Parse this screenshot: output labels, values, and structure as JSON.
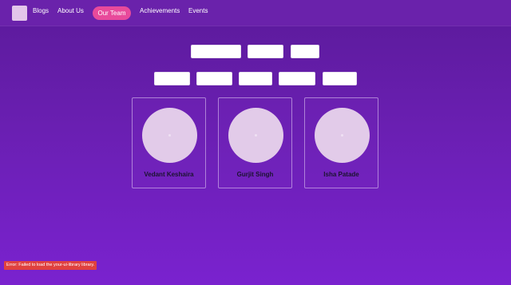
{
  "nav": {
    "items": [
      {
        "label": "Blogs"
      },
      {
        "label": "About Us"
      },
      {
        "label": "Our Team",
        "active": true
      },
      {
        "label": "Achievements"
      },
      {
        "label": "Events"
      }
    ],
    "active_color": "#e84a9b"
  },
  "filters": {
    "row1": [
      "",
      "",
      ""
    ],
    "row2": [
      "",
      "",
      "",
      "",
      ""
    ]
  },
  "team": [
    {
      "name": "Vedant Keshaira"
    },
    {
      "name": "Gurjit Singh"
    },
    {
      "name": "Isha Patade"
    }
  ],
  "error": {
    "message": "Error: Failed to load the your-ui-library library."
  },
  "colors": {
    "background_top": "#5b1a9a",
    "background_bottom": "#7a22cf",
    "error": "#e0413f"
  }
}
